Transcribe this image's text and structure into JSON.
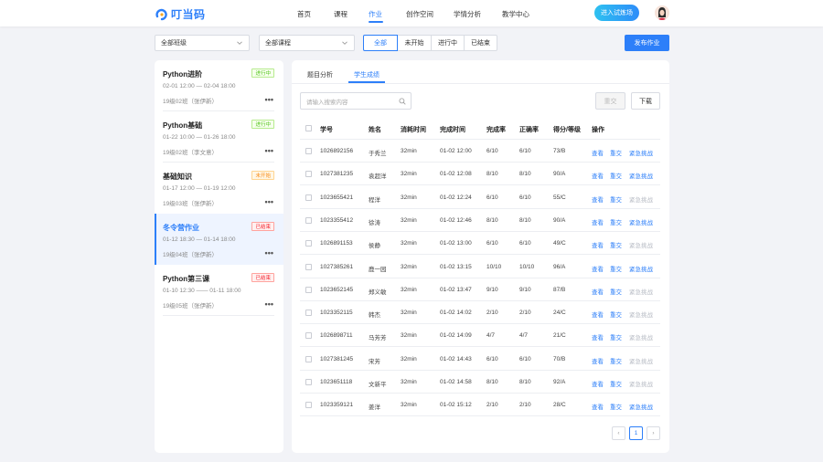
{
  "header": {
    "logo_text": "叮当码",
    "nav": [
      "首页",
      "课程",
      "作业",
      "创作空间",
      "学情分析",
      "教学中心"
    ],
    "active_nav": "作业",
    "trial_button": "进入试炼场",
    "colors": {
      "accent": "#2d7ff9"
    }
  },
  "filters": {
    "class_select": "全部班级",
    "course_select": "全部课程",
    "status_tabs": [
      "全部",
      "未开始",
      "进行中",
      "已结束"
    ],
    "active_status": "全部",
    "publish_button": "发布作业"
  },
  "homeworks": [
    {
      "name": "Python进阶",
      "status": "进行中",
      "status_color": "green",
      "time": "02-01 12:00 — 02-04 18:00",
      "class": "19级02班（张伊新）",
      "more": "•••"
    },
    {
      "name": "Python基础",
      "status": "进行中",
      "status_color": "green",
      "time": "01-22 10:00 — 01-26 18:00",
      "class": "19级02班（李文意）",
      "more": "•••"
    },
    {
      "name": "基础知识",
      "status": "未开始",
      "status_color": "orange",
      "time": "01-17 12:00 — 01-19 12:00",
      "class": "19级03班（张伊新）",
      "more": "•••"
    },
    {
      "name": "冬令营作业",
      "status": "已结束",
      "status_color": "red",
      "time": "01-12 18:30 — 01-14 18:00",
      "class": "19级04班（张伊新）",
      "more": "•••",
      "active": true
    },
    {
      "name": "Python第三课",
      "status": "已结束",
      "status_color": "red",
      "time": "01-10 12:30 —— 01-11 18:00",
      "class": "19级05班（张伊新）",
      "more": "•••"
    }
  ],
  "main": {
    "tabs": [
      "题目分析",
      "学生成绩"
    ],
    "active_tab": "学生成绩",
    "search_placeholder": "请输入搜索内容",
    "resubmit_button": "重交",
    "download_button": "下载",
    "columns": [
      "学号",
      "姓名",
      "消耗时间",
      "完成时间",
      "完成率",
      "正确率",
      "得分/等级",
      "操作"
    ],
    "rows": [
      {
        "id": "1026892156",
        "name": "于秀兰",
        "cost": "32min",
        "done": "01-02 12:00",
        "rate": "6/10",
        "correct": "6/10",
        "score": "73/B",
        "a1": "查看",
        "a2": "重交",
        "a3": "紧急挑战",
        "a3_enabled": true
      },
      {
        "id": "1027381235",
        "name": "袁超洋",
        "cost": "32min",
        "done": "01-02 12:08",
        "rate": "8/10",
        "correct": "8/10",
        "score": "90/A",
        "a1": "查看",
        "a2": "重交",
        "a3": "紧急挑战",
        "a3_enabled": true
      },
      {
        "id": "1023655421",
        "name": "程洋",
        "cost": "32min",
        "done": "01-02 12:24",
        "rate": "6/10",
        "correct": "6/10",
        "score": "55/C",
        "a1": "查看",
        "a2": "重交",
        "a3": "紧急挑战",
        "a3_enabled": false
      },
      {
        "id": "1023355412",
        "name": "徐涛",
        "cost": "32min",
        "done": "01-02 12:46",
        "rate": "8/10",
        "correct": "8/10",
        "score": "90/A",
        "a1": "查看",
        "a2": "重交",
        "a3": "紧急挑战",
        "a3_enabled": true
      },
      {
        "id": "1026891153",
        "name": "侯静",
        "cost": "32min",
        "done": "01-02 13:00",
        "rate": "6/10",
        "correct": "6/10",
        "score": "49/C",
        "a1": "查看",
        "a2": "重交",
        "a3": "紧急挑战",
        "a3_enabled": false
      },
      {
        "id": "1027385261",
        "name": "鹿一园",
        "cost": "32min",
        "done": "01-02 13:15",
        "rate": "10/10",
        "correct": "10/10",
        "score": "96/A",
        "a1": "查看",
        "a2": "重交",
        "a3": "紧急挑战",
        "a3_enabled": true
      },
      {
        "id": "1023652145",
        "name": "郑义敏",
        "cost": "32min",
        "done": "01-02 13:47",
        "rate": "9/10",
        "correct": "9/10",
        "score": "87/B",
        "a1": "查看",
        "a2": "重交",
        "a3": "紧急挑战",
        "a3_enabled": false
      },
      {
        "id": "1023352115",
        "name": "韩杰",
        "cost": "32min",
        "done": "01-02 14:02",
        "rate": "2/10",
        "correct": "2/10",
        "score": "24/C",
        "a1": "查看",
        "a2": "重交",
        "a3": "紧急挑战",
        "a3_enabled": false
      },
      {
        "id": "1026898711",
        "name": "马芳芳",
        "cost": "32min",
        "done": "01-02 14:09",
        "rate": "4/7",
        "correct": "4/7",
        "score": "21/C",
        "a1": "查看",
        "a2": "重交",
        "a3": "紧急挑战",
        "a3_enabled": false
      },
      {
        "id": "1027381245",
        "name": "宋芳",
        "cost": "32min",
        "done": "01-02 14:43",
        "rate": "6/10",
        "correct": "6/10",
        "score": "70/B",
        "a1": "查看",
        "a2": "重交",
        "a3": "紧急挑战",
        "a3_enabled": false
      },
      {
        "id": "1023651118",
        "name": "文新平",
        "cost": "32min",
        "done": "01-02 14:58",
        "rate": "8/10",
        "correct": "8/10",
        "score": "92/A",
        "a1": "查看",
        "a2": "重交",
        "a3": "紧急挑战",
        "a3_enabled": false
      },
      {
        "id": "1023359121",
        "name": "姜洋",
        "cost": "32min",
        "done": "01-02 15:12",
        "rate": "2/10",
        "correct": "2/10",
        "score": "28/C",
        "a1": "查看",
        "a2": "重交",
        "a3": "紧急挑战",
        "a3_enabled": true
      }
    ],
    "pagination": {
      "prev": "‹",
      "current": "1",
      "next": "›"
    }
  }
}
